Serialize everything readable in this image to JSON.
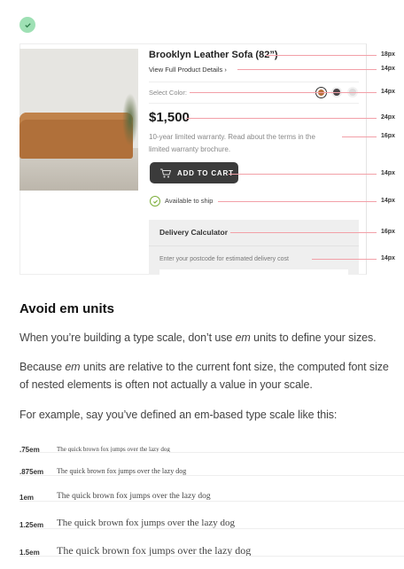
{
  "product": {
    "title": "Brooklyn Leather Sofa (82”)",
    "details_link": "View Full Product Details",
    "details_arrow": "›",
    "select_color": "Select Color:",
    "swatches": [
      "#b86f3a",
      "#4a4447",
      "#dddddd"
    ],
    "price": "$1,500",
    "warranty_line1": "10-year limited warranty. Read about the terms in the",
    "warranty_line2": "limited warranty brochure.",
    "add_to_cart": "ADD TO CART",
    "available": "Available to ship",
    "delivery_title": "Delivery Calculator",
    "delivery_prompt": "Enter your postcode for estimated delivery cost"
  },
  "annotations": [
    "18px",
    "14px",
    "14px",
    "24px",
    "16px",
    "14px",
    "14px",
    "16px",
    "14px"
  ],
  "article": {
    "heading": "Avoid em units",
    "p1_a": "When you’re building a type scale, don’t use ",
    "p1_em": "em",
    "p1_b": " units to define your sizes.",
    "p2_a": "Because ",
    "p2_em": "em",
    "p2_b": " units are relative to the current font size, the computed font size",
    "p2_line2": "of nested elements is often not actually a value in your scale.",
    "p3": "For example, say you’ve defined an em-based type scale like this:"
  },
  "type_scale": [
    {
      "label": ".75em",
      "sample": "The quick brown fox jumps over the lazy dog"
    },
    {
      "label": ".875em",
      "sample": "The quick brown fox jumps over the lazy dog"
    },
    {
      "label": "1em",
      "sample": "The quick brown fox jumps over the lazy dog"
    },
    {
      "label": "1.25em",
      "sample": "The quick brown fox jumps over the lazy dog"
    },
    {
      "label": "1.5em",
      "sample": "The quick brown fox jumps over the lazy dog"
    }
  ]
}
